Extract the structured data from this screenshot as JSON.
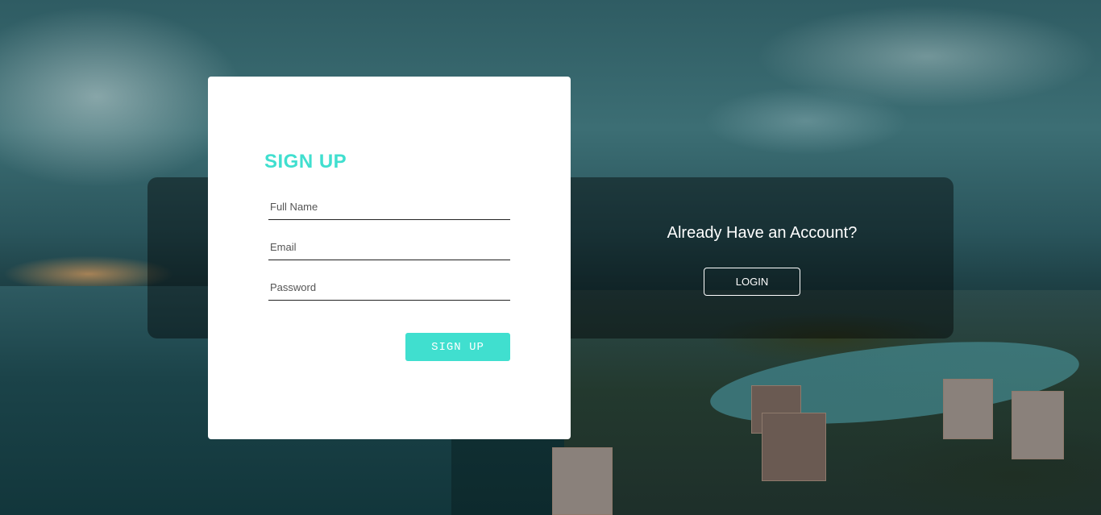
{
  "signup": {
    "title": "SIGN UP",
    "fields": {
      "full_name": {
        "placeholder": "Full Name",
        "value": ""
      },
      "email": {
        "placeholder": "Email",
        "value": ""
      },
      "password": {
        "placeholder": "Password",
        "value": ""
      }
    },
    "submit_label": "SIGN UP"
  },
  "login": {
    "prompt": "Already Have an Account?",
    "button_label": "LOGIN"
  },
  "colors": {
    "accent": "#40dfcf",
    "card_background": "#ffffff",
    "overlay": "rgba(0,0,0,0.42)"
  }
}
